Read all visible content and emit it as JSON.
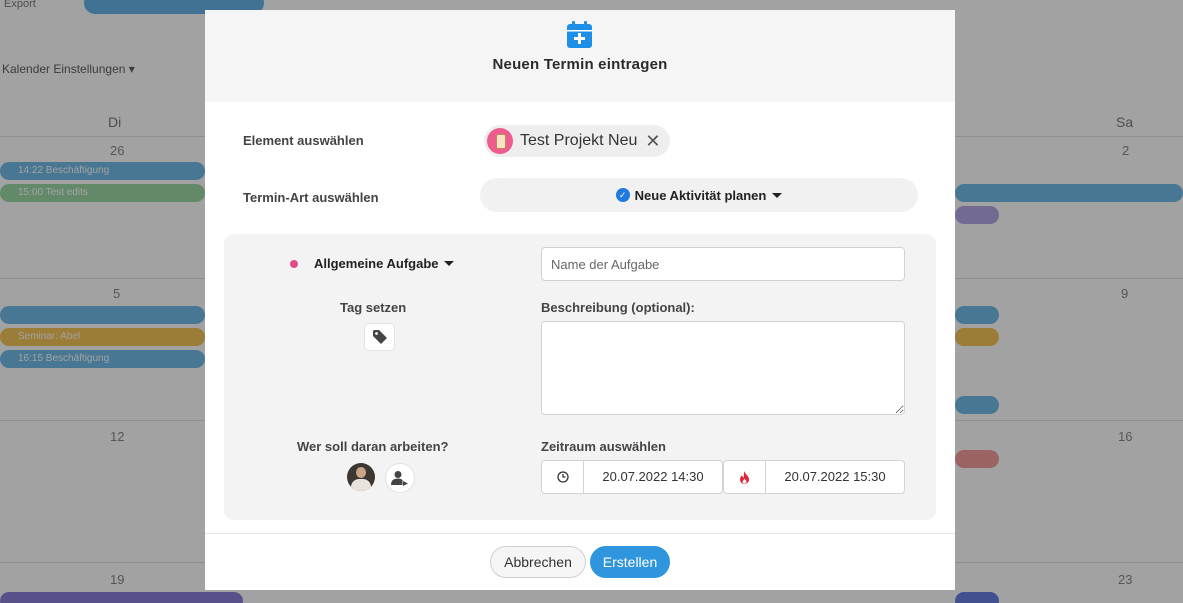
{
  "background": {
    "topbar_text": "Export",
    "calendar_settings": "Kalender Einstellungen",
    "day_names": [
      "Di",
      "Sa"
    ],
    "day_numbers": [
      "26",
      "2",
      "5",
      "9",
      "12",
      "16",
      "19",
      "23"
    ],
    "events": [
      "14:22 Beschäftigung",
      "15:00 Test edits",
      "Seminar: Abel",
      "16:15 Beschäftigung"
    ]
  },
  "modal": {
    "title": "Neuen Termin eintragen",
    "element_label": "Element auswählen",
    "element_chip": "Test Projekt Neu",
    "type_label": "Termin-Art auswählen",
    "type_value": "Neue Aktivität planen",
    "task_type": "Allgemeine Aufgabe",
    "task_name_placeholder": "Name der Aufgabe",
    "tag_label": "Tag setzen",
    "description_label": "Beschreibung (optional):",
    "who_label": "Wer soll daran arbeiten?",
    "period_label": "Zeitraum auswählen",
    "start": "20.07.2022 14:30",
    "end": "20.07.2022 15:30",
    "cancel": "Abbrechen",
    "create": "Erstellen"
  },
  "colors": {
    "accent": "#2f95dc",
    "check": "#1f7ae0",
    "task_dot": "#e24c8a",
    "end_icon": "#e0263a"
  }
}
